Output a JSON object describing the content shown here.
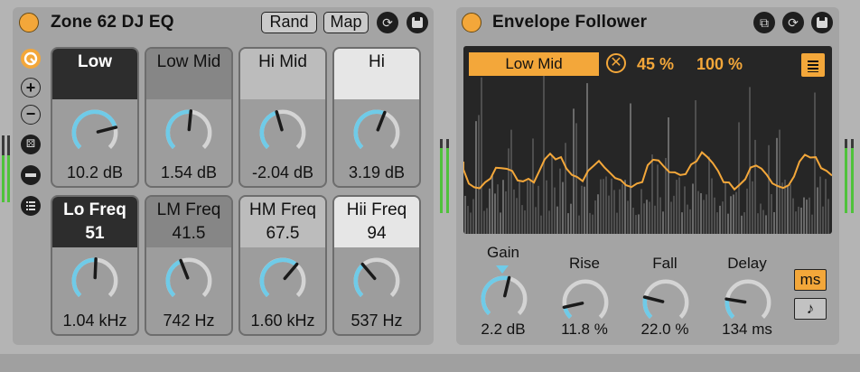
{
  "colors": {
    "accent": "#f3a73a",
    "knob_arc": "#6fcbe8",
    "panel": "#a4a4a4",
    "display_bg": "#262626",
    "meter_green": "#4fc23b"
  },
  "eq": {
    "title": "Zone 62 DJ EQ",
    "rand_label": "Rand",
    "map_label": "Map",
    "icons": [
      "power-icon",
      "hot-swap-icon",
      "save-icon",
      "macro-variations-icon",
      "add-icon",
      "remove-icon",
      "randomize-icon",
      "minus-icon",
      "list-icon"
    ],
    "bands": [
      {
        "label": "Low",
        "value": "10.2 dB",
        "level": 0.78
      },
      {
        "label": "Low Mid",
        "value": "1.54 dB",
        "level": 0.52
      },
      {
        "label": "Hi Mid",
        "value": "-2.04 dB",
        "level": 0.44
      },
      {
        "label": "Hi",
        "value": "3.19 dB",
        "level": 0.58
      }
    ],
    "freqs": [
      {
        "label": "Lo Freq",
        "sub": "51",
        "value": "1.04 kHz",
        "level": 0.51
      },
      {
        "label": "LM Freq",
        "sub": "41.5",
        "value": "742 Hz",
        "level": 0.42
      },
      {
        "label": "HM Freq",
        "sub": "67.5",
        "value": "1.60 kHz",
        "level": 0.65
      },
      {
        "label": "Hii Freq",
        "sub": "94",
        "value": "537 Hz",
        "level": 0.35
      }
    ]
  },
  "env": {
    "title": "Envelope Follower",
    "target": "Low Mid",
    "min_pct": "45 %",
    "max_pct": "100 %",
    "knobs": [
      {
        "label": "Gain",
        "value": "2.2 dB",
        "level": 0.55
      },
      {
        "label": "Rise",
        "value": "11.8 %",
        "level": 0.12
      },
      {
        "label": "Fall",
        "value": "22.0 %",
        "level": 0.22
      },
      {
        "label": "Delay",
        "value": "134 ms",
        "level": 0.2
      }
    ],
    "ms_label": "ms",
    "note_label": "♪"
  }
}
